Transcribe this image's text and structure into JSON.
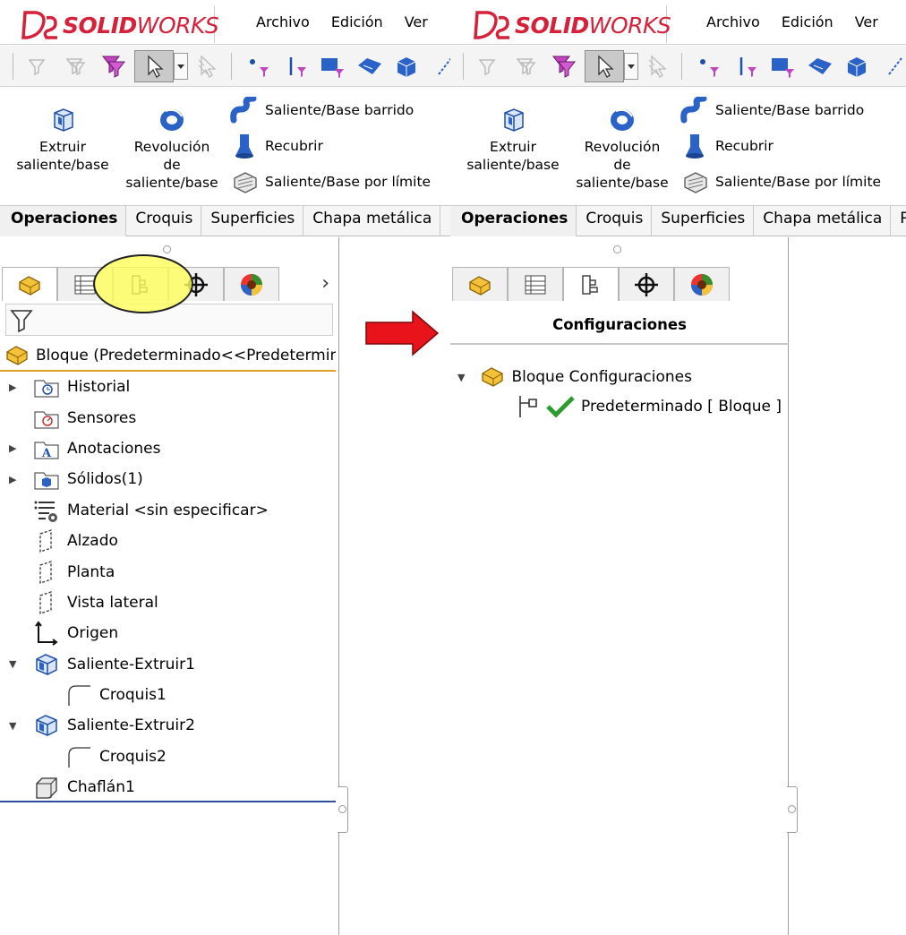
{
  "app": {
    "logo_prefix": "SOLID",
    "logo_suffix": "WORKS",
    "brand_color": "#d6213a"
  },
  "menu": [
    "Archivo",
    "Edición",
    "Ver"
  ],
  "ribbon": {
    "extrude_line1": "Extruir",
    "extrude_line2": "saliente/base",
    "revolve_line1": "Revolución",
    "revolve_line2": "de",
    "revolve_line3": "saliente/base",
    "sweep": "Saliente/Base barrido",
    "loft": "Recubrir",
    "boundary": "Saliente/Base por límite"
  },
  "tabs": [
    "Operaciones",
    "Croquis",
    "Superficies",
    "Chapa metálica"
  ],
  "right_tab_extra": "P",
  "tree": {
    "root": "Bloque  (Predeterminado<<Predeterminado>",
    "items": [
      {
        "label": "Historial"
      },
      {
        "label": "Sensores"
      },
      {
        "label": "Anotaciones"
      },
      {
        "label": "Sólidos(1)"
      },
      {
        "label": "Material <sin especificar>"
      },
      {
        "label": "Alzado"
      },
      {
        "label": "Planta"
      },
      {
        "label": "Vista lateral"
      },
      {
        "label": "Origen"
      },
      {
        "label": "Saliente-Extruir1"
      },
      {
        "label": "Croquis1"
      },
      {
        "label": "Saliente-Extruir2"
      },
      {
        "label": "Croquis2"
      },
      {
        "label": "Chaflán1"
      }
    ]
  },
  "config": {
    "title": "Configuraciones",
    "root": "Bloque Configuraciones",
    "child": "Predeterminado [ Bloque ]"
  },
  "colors": {
    "arrow": "#e8131b",
    "highlight": "#ffff5a",
    "tree_accent": "#e6a020",
    "tree_end": "#2d4f9e"
  }
}
